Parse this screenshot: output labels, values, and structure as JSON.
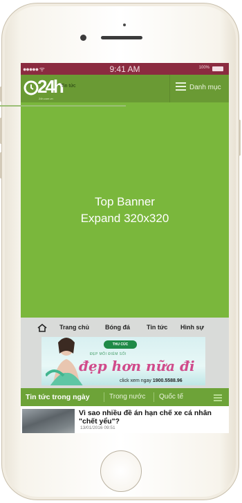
{
  "status_bar": {
    "signal": "●●●●● ᯤ",
    "time": "9:41 AM",
    "battery_percent": "100%"
  },
  "header": {
    "logo_text": "24h",
    "logo_sub": "24h.com.vn",
    "section_label": "Tin tức",
    "menu_label": "Danh mục"
  },
  "banner": {
    "line1": "Top Banner",
    "line2": "Expand 320x320"
  },
  "nav": {
    "items": [
      {
        "label": "Trang chủ"
      },
      {
        "label": "Bóng đá"
      },
      {
        "label": "Tin tức"
      },
      {
        "label": "Hình sự"
      }
    ]
  },
  "ad": {
    "brand": "THU CÚC",
    "tagline": "ĐẸP MỖI ĐIỂM SỐI",
    "headline": "đẹp hơn nữa đi",
    "cta_prefix": "click xem ngay",
    "phone": "1900.5588.96"
  },
  "tabs": [
    {
      "label": "Tin tức trong ngày",
      "active": true
    },
    {
      "label": "Trong nước",
      "active": false
    },
    {
      "label": "Quốc tế",
      "active": false
    }
  ],
  "news": {
    "title": "Vì sao nhiều đề án hạn chế xe cá nhân \"chết yểu\"?",
    "date": "13/01/2016 09:51"
  },
  "colors": {
    "banner_green": "#7ab73c",
    "header_green": "#6a9a34",
    "status_bar": "#8b2b40"
  }
}
